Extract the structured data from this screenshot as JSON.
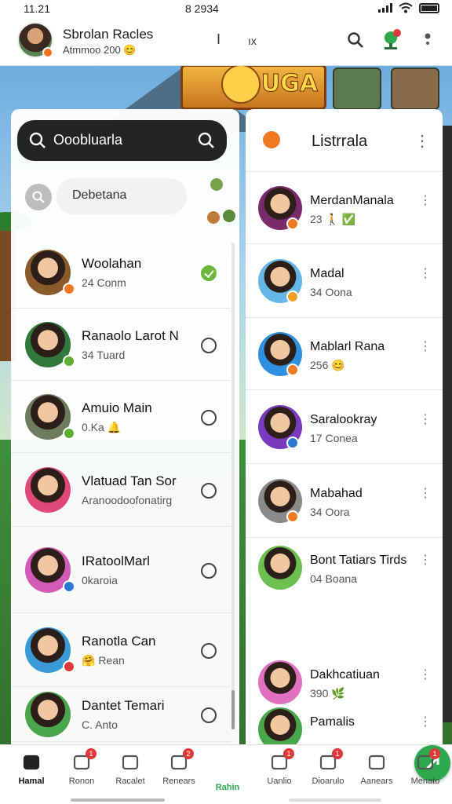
{
  "status_bar": {
    "time": "11.21",
    "center": "8 2934"
  },
  "header": {
    "name": "Sbrolan Racles",
    "subtitle": "Atmmoo 200 😊",
    "glyph_a": "I",
    "glyph_b": "ıx"
  },
  "left_panel": {
    "search_value": "Ooobluarla",
    "filter_label": "Debetana",
    "items": [
      {
        "name": "Woolahan",
        "sub": "24 Conm",
        "checked": true,
        "avatar_color": "#8a5a2a",
        "badge_color": "#f07a22"
      },
      {
        "name": "Ranaolo Larot N",
        "sub": "34 Tuard",
        "checked": false,
        "avatar_color": "#2f7a3a",
        "badge_color": "#5cb030"
      },
      {
        "name": "Amuio Main",
        "sub": "0.Ka 🔔",
        "checked": false,
        "avatar_color": "#6b7d5a",
        "badge_color": "#5cb030"
      },
      {
        "name": "Vlatuad Tan Sor",
        "sub": "Aranoodoofonatirg",
        "checked": false,
        "avatar_color": "#e0487a",
        "badge_color": ""
      },
      {
        "name": "IRatoolMarl",
        "sub": "0karoia",
        "checked": false,
        "avatar_color": "#d45ab8",
        "badge_color": "#2a77d4"
      },
      {
        "name": "Ranotla Can",
        "sub": "🤗 Rean",
        "checked": false,
        "avatar_color": "#3a9ad8",
        "badge_color": "#e0393a"
      },
      {
        "name": "Dantet Temari",
        "sub": "C. Anto",
        "checked": false,
        "avatar_color": "#4aa64a",
        "badge_color": ""
      }
    ]
  },
  "right_panel": {
    "title": "Listrrala",
    "items": [
      {
        "name": "MerdanManala",
        "sub": "23 🚶 ✅",
        "avatar_color": "#7a2a6a",
        "badge_color": "#f07a22"
      },
      {
        "name": "Madal",
        "sub": "34 Oona",
        "avatar_color": "#63b6e6",
        "badge_color": "#f0a020"
      },
      {
        "name": "Mablarl Rana",
        "sub": "256 😊",
        "avatar_color": "#2f8fe0",
        "badge_color": "#f07a22"
      },
      {
        "name": "Saralookray",
        "sub": "17 Conea",
        "avatar_color": "#7a3ac0",
        "badge_color": "#2a77d4"
      },
      {
        "name": "Mabahad",
        "sub": "34 Oora",
        "avatar_color": "#8a8a8a",
        "badge_color": "#f07a22"
      },
      {
        "name": "Bont Tatiars Tirds",
        "sub": "04 Boana",
        "avatar_color": "#6cc050",
        "badge_color": ""
      },
      {
        "name": "Dakhcatiuan",
        "sub": "390 🌿",
        "avatar_color": "#e070c0",
        "badge_color": ""
      },
      {
        "name": "Pamalis",
        "sub": "",
        "avatar_color": "#4aa64a",
        "badge_color": ""
      }
    ]
  },
  "bottom_nav": {
    "items": [
      {
        "label": "Hamal",
        "badge": ""
      },
      {
        "label": "Ronon",
        "badge": "1"
      },
      {
        "label": "Racalet",
        "badge": ""
      },
      {
        "label": "Renears",
        "badge": "2"
      },
      {
        "label": "Rahin",
        "badge": ""
      },
      {
        "label": "Uanlio",
        "badge": "1"
      },
      {
        "label": "Dioarulo",
        "badge": "1"
      },
      {
        "label": "Aanears",
        "badge": ""
      },
      {
        "label": "Menato",
        "badge": "1"
      }
    ]
  },
  "colors": {
    "accent": "#2da84f",
    "dark_search": "#242424"
  }
}
